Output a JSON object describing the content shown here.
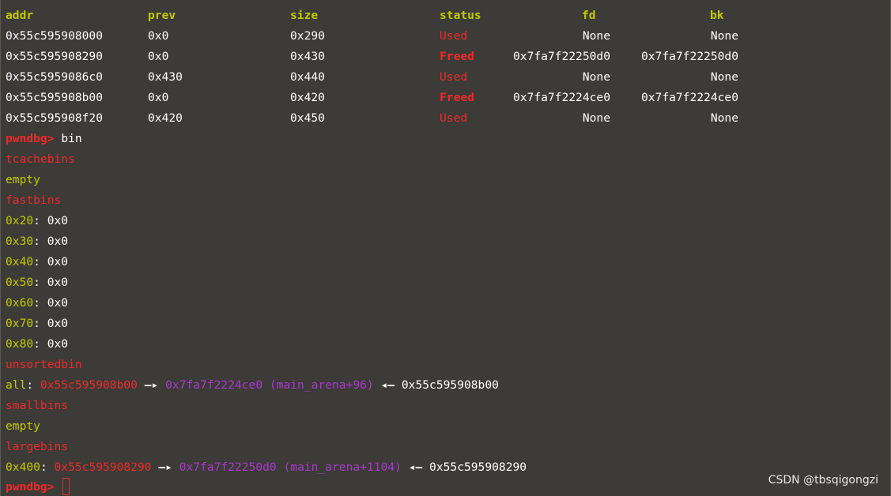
{
  "heap_table": {
    "headers": {
      "addr": "addr",
      "prev": "prev",
      "size": "size",
      "status": "status",
      "fd": "fd",
      "bk": "bk"
    },
    "rows": [
      {
        "addr": "0x55c595908000",
        "prev": "0x0",
        "size": "0x290",
        "status": "Used",
        "fd": "None",
        "bk": "None"
      },
      {
        "addr": "0x55c595908290",
        "prev": "0x0",
        "size": "0x430",
        "status": "Freed",
        "fd": "0x7fa7f22250d0",
        "bk": "0x7fa7f22250d0"
      },
      {
        "addr": "0x55c5959086c0",
        "prev": "0x430",
        "size": "0x440",
        "status": "Used",
        "fd": "None",
        "bk": "None"
      },
      {
        "addr": "0x55c595908b00",
        "prev": "0x0",
        "size": "0x420",
        "status": "Freed",
        "fd": "0x7fa7f2224ce0",
        "bk": "0x7fa7f2224ce0"
      },
      {
        "addr": "0x55c595908f20",
        "prev": "0x420",
        "size": "0x450",
        "status": "Used",
        "fd": "None",
        "bk": "None"
      }
    ]
  },
  "prompt": "pwndbg>",
  "command": "bin",
  "bins": {
    "tcache_label": "tcachebins",
    "tcache_value": "empty",
    "fast_label": "fastbins",
    "fast_entries": [
      {
        "size": "0x20",
        "value": "0x0"
      },
      {
        "size": "0x30",
        "value": "0x0"
      },
      {
        "size": "0x40",
        "value": "0x0"
      },
      {
        "size": "0x50",
        "value": "0x0"
      },
      {
        "size": "0x60",
        "value": "0x0"
      },
      {
        "size": "0x70",
        "value": "0x0"
      },
      {
        "size": "0x80",
        "value": "0x0"
      }
    ],
    "unsorted_label": "unsortedbin",
    "unsorted_entry": {
      "key": "all",
      "chunk": "0x55c595908b00",
      "target": "0x7fa7f2224ce0 (main_arena+96)",
      "back": "0x55c595908b00"
    },
    "small_label": "smallbins",
    "small_value": "empty",
    "large_label": "largebins",
    "large_entry": {
      "key": "0x400",
      "chunk": "0x55c595908290",
      "target": "0x7fa7f22250d0 (main_arena+1104)",
      "back": "0x55c595908290"
    }
  },
  "watermark": "CSDN @tbsqigongzi",
  "colors": {
    "background": "#3c3b37",
    "yellow": "#c4c900",
    "red": "#ef2929",
    "magenta": "#ad36d1",
    "text": "#ffffff"
  }
}
